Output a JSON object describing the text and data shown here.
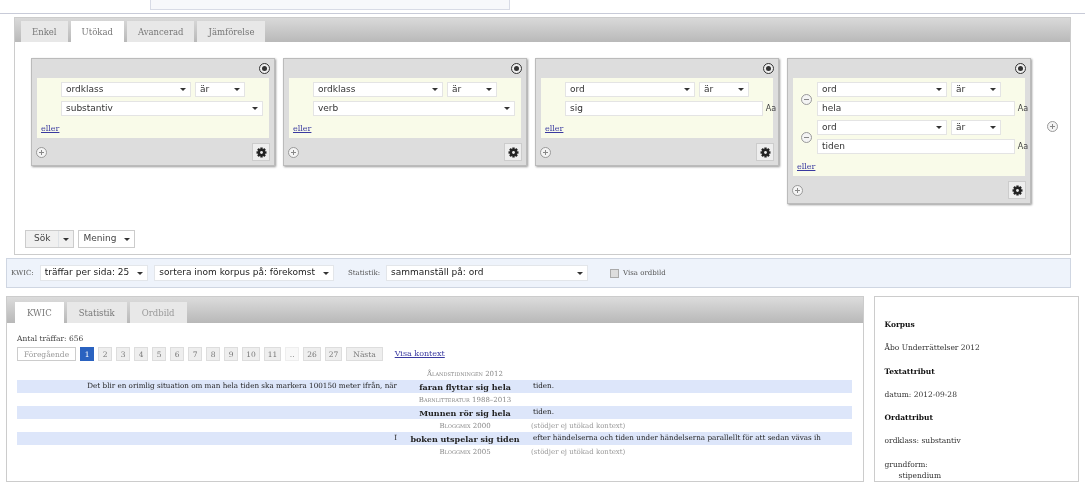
{
  "tabs": [
    {
      "label": "Enkel",
      "selected": false
    },
    {
      "label": "Utökad",
      "selected": true
    },
    {
      "label": "Avancerad",
      "selected": false
    },
    {
      "label": "Jämförelse",
      "selected": false
    }
  ],
  "token_boxes": [
    {
      "or_label": "eller",
      "conditions": [
        {
          "kind": "select",
          "attribute": "ordklass",
          "operator": "är",
          "value": "substantiv"
        }
      ]
    },
    {
      "or_label": "eller",
      "conditions": [
        {
          "kind": "select",
          "attribute": "ordklass",
          "operator": "är",
          "value": "verb"
        }
      ]
    },
    {
      "or_label": "eller",
      "conditions": [
        {
          "kind": "text",
          "attribute": "ord",
          "operator": "är",
          "value": "sig",
          "case_label": "Aa"
        }
      ]
    },
    {
      "or_label": "eller",
      "conditions": [
        {
          "kind": "text",
          "attribute": "ord",
          "operator": "är",
          "value": "hela",
          "case_label": "Aa"
        },
        {
          "kind": "text",
          "attribute": "ord",
          "operator": "är",
          "value": "tiden",
          "case_label": "Aa"
        }
      ]
    }
  ],
  "search": {
    "button": "Sök",
    "mode": "Mening"
  },
  "options_bar": {
    "kwic_label": "KWIC:",
    "hits_per_page": "träffar per sida: 25",
    "sort": "sortera inom korpus på: förekomst",
    "stats_label": "Statistik:",
    "stats": "sammanställ på: ord",
    "word_picture": {
      "label": "Visa ordbild",
      "checked": false
    }
  },
  "result_tabs": [
    {
      "label": "KWIC",
      "selected": true,
      "disabled": false
    },
    {
      "label": "Statistik",
      "selected": false,
      "disabled": false
    },
    {
      "label": "Ordbild",
      "selected": false,
      "disabled": true
    }
  ],
  "hit_count": "Antal träffar: 656",
  "pagination": [
    {
      "kind": "prev",
      "label": "Föregående",
      "selected": false,
      "disabled": true
    },
    {
      "kind": "page",
      "label": "1",
      "selected": true,
      "disabled": false
    },
    {
      "kind": "page",
      "label": "2",
      "selected": false,
      "disabled": false
    },
    {
      "kind": "page",
      "label": "3",
      "selected": false,
      "disabled": false
    },
    {
      "kind": "page",
      "label": "4",
      "selected": false,
      "disabled": false
    },
    {
      "kind": "page",
      "label": "5",
      "selected": false,
      "disabled": false
    },
    {
      "kind": "page",
      "label": "6",
      "selected": false,
      "disabled": false
    },
    {
      "kind": "page",
      "label": "7",
      "selected": false,
      "disabled": false
    },
    {
      "kind": "page",
      "label": "8",
      "selected": false,
      "disabled": false
    },
    {
      "kind": "page",
      "label": "9",
      "selected": false,
      "disabled": false
    },
    {
      "kind": "page",
      "label": "10",
      "selected": false,
      "disabled": false
    },
    {
      "kind": "page",
      "label": "11",
      "selected": false,
      "disabled": false
    },
    {
      "kind": "ellipsis",
      "label": "..",
      "selected": false,
      "disabled": false
    },
    {
      "kind": "page",
      "label": "26",
      "selected": false,
      "disabled": false
    },
    {
      "kind": "page",
      "label": "27",
      "selected": false,
      "disabled": false
    },
    {
      "kind": "next",
      "label": "Nästa",
      "selected": false,
      "disabled": false
    }
  ],
  "show_context": "Visa kontext",
  "kwic_rows": [
    {
      "kind": "corpus",
      "label": "Ålandstidningen 2012"
    },
    {
      "kind": "line",
      "left": "Det blir en orimlig situation om man hela tiden ska markera 100150 meter ifrån, när",
      "match": "faran flyttar sig hela",
      "right": "tiden."
    },
    {
      "kind": "corpus",
      "label": "Barnlitteratur 1988–2013"
    },
    {
      "kind": "line",
      "left": "",
      "match": "Munnen rör sig hela",
      "right": "tiden."
    },
    {
      "kind": "corpus",
      "label": "Bloggmix 2000",
      "note": "(stödjer ej utökad kontext)"
    },
    {
      "kind": "line",
      "left": "I",
      "match": "boken utspelar sig tiden",
      "right": "efter händelserna och tiden under händelserna parallellt för att sedan vävas ih"
    },
    {
      "kind": "corpus",
      "label": "Bloggmix 2005",
      "note": "(stödjer ej utökad kontext)"
    }
  ],
  "sidebar": [
    {
      "kind": "heading",
      "text": "Korpus"
    },
    {
      "kind": "text",
      "text": "Åbo Underrättelser 2012"
    },
    {
      "kind": "heading",
      "text": "Textattribut"
    },
    {
      "kind": "text",
      "text": "datum: 2012-09-28"
    },
    {
      "kind": "heading",
      "text": "Ordattribut"
    },
    {
      "kind": "text",
      "text": "ordklass: substantiv"
    },
    {
      "kind": "line",
      "text": "grundform:"
    },
    {
      "kind": "indented",
      "text": "stipendium"
    }
  ]
}
